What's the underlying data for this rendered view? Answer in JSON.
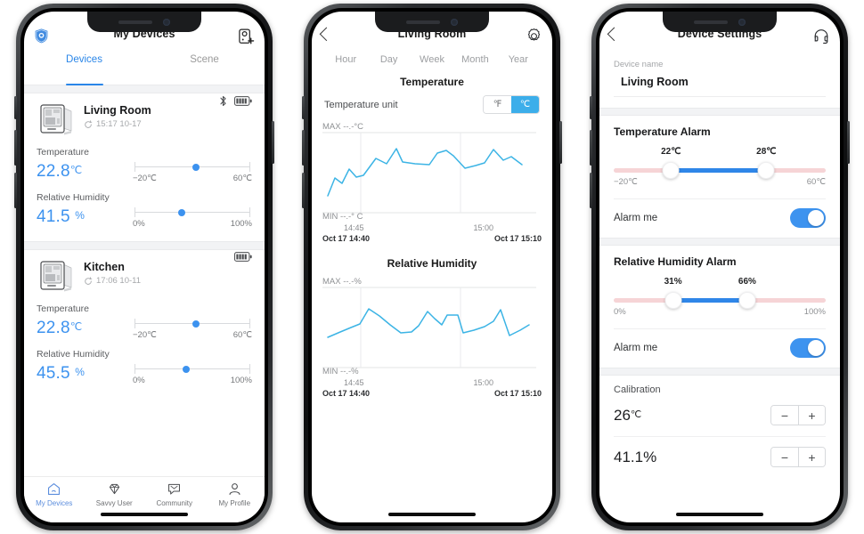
{
  "accent": "#2a86e8",
  "chart_line_color": "#3cb4e5",
  "phone1": {
    "appbar": {
      "title": "My Devices",
      "logo_icon": "shield-logo-icon",
      "add_icon": "add-device-icon"
    },
    "tabs": [
      {
        "label": "Devices",
        "active": true
      },
      {
        "label": "Scene",
        "active": false
      }
    ],
    "devices": [
      {
        "name": "Living Room",
        "timestamp": "15:17 10-17",
        "bluetooth": true,
        "battery": "full",
        "temperature": {
          "label": "Temperature",
          "value": "22.8",
          "unit": "℃",
          "min": "−20℃",
          "max": "60℃",
          "knob_pct": 53
        },
        "humidity": {
          "label": "Relative Humidity",
          "value": "41.5",
          "unit": "%",
          "min": "0%",
          "max": "100%",
          "knob_pct": 41
        }
      },
      {
        "name": "Kitchen",
        "timestamp": "17:06 10-11",
        "bluetooth": false,
        "battery": "full",
        "temperature": {
          "label": "Temperature",
          "value": "22.8",
          "unit": "℃",
          "min": "−20℃",
          "max": "60℃",
          "knob_pct": 53
        },
        "humidity": {
          "label": "Relative Humidity",
          "value": "45.5",
          "unit": "%",
          "min": "0%",
          "max": "100%",
          "knob_pct": 45
        }
      }
    ],
    "tabbar": [
      {
        "label": "My Devices",
        "icon": "home-icon",
        "active": true
      },
      {
        "label": "Savvy User",
        "icon": "diamond-icon",
        "active": false
      },
      {
        "label": "Community",
        "icon": "message-icon",
        "active": false
      },
      {
        "label": "My Profile",
        "icon": "person-icon",
        "active": false
      }
    ]
  },
  "phone2": {
    "appbar": {
      "title": "Living Room",
      "back_icon": "chevron-left-icon",
      "settings_icon": "gear-icon"
    },
    "range_tabs": [
      "Hour",
      "Day",
      "Week",
      "Month",
      "Year"
    ],
    "temperature_unit": {
      "label": "Temperature unit",
      "options": [
        "℉",
        "℃"
      ],
      "selected": "℃"
    },
    "charts": [
      {
        "title": "Temperature",
        "max_label": "MAX --.-°C",
        "min_label": "MIN --.-° C",
        "tick_labels": [
          "14:45",
          "15:00"
        ],
        "foot_left": "Oct 17  14:40",
        "foot_right": "Oct 17  15:10"
      },
      {
        "title": "Relative Humidity",
        "max_label": "MAX --.-%",
        "min_label": "MIN --.-%",
        "tick_labels": [
          "14:45",
          "15:00"
        ],
        "foot_left": "Oct 17  14:40",
        "foot_right": "Oct 17  15:10"
      }
    ]
  },
  "phone3": {
    "appbar": {
      "title": "Device Settings",
      "back_icon": "chevron-left-icon",
      "support_icon": "headset-icon"
    },
    "device_name": {
      "label": "Device name",
      "value": "Living Room"
    },
    "temperature_alarm": {
      "title": "Temperature Alarm",
      "low_value": "22℃",
      "high_value": "28℃",
      "low_pct": 27,
      "high_pct": 72,
      "range_min": "−20℃",
      "range_max": "60℃",
      "alarm_label": "Alarm me",
      "alarm_on": true
    },
    "humidity_alarm": {
      "title": "Relative Humidity Alarm",
      "low_value": "31%",
      "high_value": "66%",
      "low_pct": 28,
      "high_pct": 63,
      "range_min": "0%",
      "range_max": "100%",
      "alarm_label": "Alarm me",
      "alarm_on": true
    },
    "calibration": {
      "title": "Calibration",
      "rows": [
        {
          "value": "26",
          "unit": "℃",
          "minus": "−",
          "plus": "+"
        },
        {
          "value": "41.1%",
          "unit": "",
          "minus": "−",
          "plus": "+"
        }
      ]
    }
  },
  "chart_data": [
    {
      "type": "line",
      "title": "Temperature",
      "ylabel": "°C",
      "xlabel": "time",
      "grid": true,
      "legend": "none",
      "x": [
        "14:40",
        "14:42",
        "14:43",
        "14:44",
        "14:45",
        "14:46",
        "14:48",
        "14:50",
        "14:52",
        "14:53",
        "14:55",
        "14:57",
        "14:58",
        "15:00",
        "15:01",
        "15:03",
        "15:04",
        "15:05",
        "15:06",
        "15:08",
        "15:09",
        "15:10"
      ],
      "values": [
        21.4,
        22.5,
        22.0,
        23.2,
        22.6,
        22.7,
        23.6,
        23.3,
        24.1,
        23.4,
        23.3,
        23.2,
        24.0,
        24.2,
        23.7,
        22.8,
        23.0,
        23.2,
        24.2,
        23.4,
        23.6,
        23.0
      ],
      "ylim": [
        20.5,
        25.5
      ],
      "tick_labels": [
        "14:45",
        "15:00"
      ],
      "max_label": "MAX --.-°C",
      "min_label": "MIN --.-° C"
    },
    {
      "type": "line",
      "title": "Relative Humidity",
      "ylabel": "%",
      "xlabel": "time",
      "grid": true,
      "legend": "none",
      "x": [
        "14:40",
        "14:42",
        "14:43",
        "14:44",
        "14:45",
        "14:46",
        "14:48",
        "14:50",
        "14:52",
        "14:53",
        "14:55",
        "14:57",
        "14:58",
        "15:00",
        "15:01",
        "15:03",
        "15:04",
        "15:05",
        "15:06",
        "15:08",
        "15:09",
        "15:10"
      ],
      "values": [
        40.0,
        41.0,
        41.6,
        43.8,
        42.8,
        41.6,
        40.6,
        40.6,
        41.4,
        43.2,
        41.4,
        42.4,
        42.4,
        40.3,
        40.4,
        41.0,
        41.6,
        43.4,
        41.0,
        39.6,
        40.4,
        41.2
      ],
      "ylim": [
        38.0,
        45.5
      ],
      "tick_labels": [
        "14:45",
        "15:00"
      ],
      "max_label": "MAX --.-%",
      "min_label": "MIN --.-%"
    }
  ]
}
